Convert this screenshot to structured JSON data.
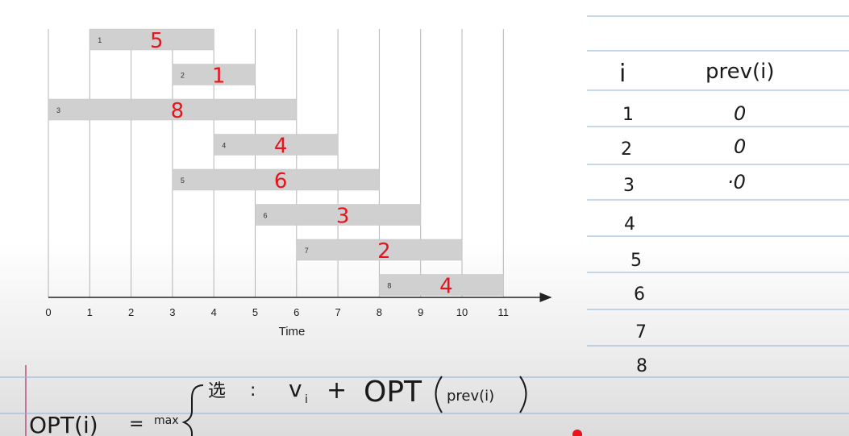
{
  "chart_data": {
    "type": "gantt",
    "xlabel": "Time",
    "x_ticks": [
      "0",
      "1",
      "2",
      "3",
      "4",
      "5",
      "6",
      "7",
      "8",
      "9",
      "10",
      "11"
    ],
    "xlim": [
      0,
      12
    ],
    "jobs": [
      {
        "id": "1",
        "start": 1,
        "end": 4,
        "weight": "5"
      },
      {
        "id": "2",
        "start": 3,
        "end": 5,
        "weight": "1"
      },
      {
        "id": "3",
        "start": 0,
        "end": 6,
        "weight": "8"
      },
      {
        "id": "4",
        "start": 4,
        "end": 7,
        "weight": "4"
      },
      {
        "id": "5",
        "start": 3,
        "end": 8,
        "weight": "6"
      },
      {
        "id": "6",
        "start": 5,
        "end": 9,
        "weight": "3"
      },
      {
        "id": "7",
        "start": 6,
        "end": 10,
        "weight": "2"
      },
      {
        "id": "8",
        "start": 8,
        "end": 11,
        "weight": "4"
      }
    ],
    "colors": {
      "bar": "#d0d0d0",
      "weight": "#e8141d",
      "grid": "#b4b4b4"
    }
  },
  "table": {
    "header_i": "i",
    "header_prev": "prev(i)",
    "rows": [
      {
        "i": "1",
        "prev": "0"
      },
      {
        "i": "2",
        "prev": "0"
      },
      {
        "i": "3",
        "prev": "·0"
      },
      {
        "i": "4",
        "prev": ""
      },
      {
        "i": "5",
        "prev": ""
      },
      {
        "i": "6",
        "prev": ""
      },
      {
        "i": "7",
        "prev": ""
      },
      {
        "i": "8",
        "prev": ""
      }
    ]
  },
  "formula": {
    "lhs": "OPT(i)",
    "eq": "=",
    "max": "max",
    "case_label": "选",
    "colon": ":",
    "vi": "v",
    "vi_sub": "i",
    "plus": "+",
    "opt": "OPT",
    "arg": "prev(i)"
  }
}
